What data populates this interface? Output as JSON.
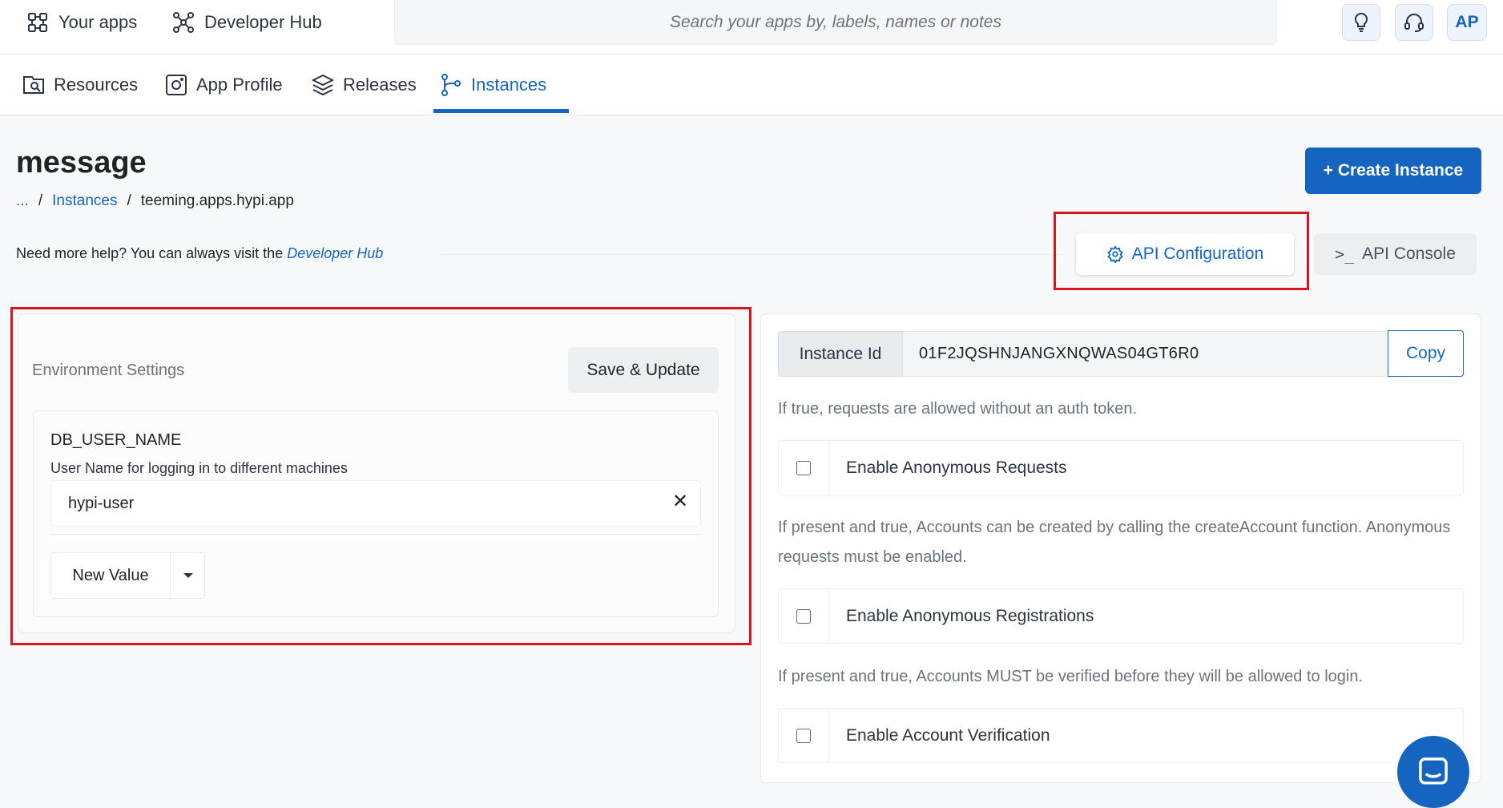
{
  "topbar": {
    "your_apps": "Your apps",
    "developer_hub": "Developer Hub",
    "search_placeholder": "Search your apps by, labels, names or notes",
    "avatar_initials": "AP"
  },
  "tabs": [
    {
      "label": "Resources",
      "icon": "resources-icon"
    },
    {
      "label": "App Profile",
      "icon": "app-profile-icon"
    },
    {
      "label": "Releases",
      "icon": "layers-icon"
    },
    {
      "label": "Instances",
      "icon": "branch-icon",
      "active": true
    }
  ],
  "page": {
    "title": "message",
    "breadcrumb": {
      "ellipsis": "...",
      "sep": "/",
      "instances": "Instances",
      "current": "teeming.apps.hypi.app"
    },
    "create_button": "+ Create Instance",
    "help_prefix": "Need more help? You can always visit the ",
    "help_link": "Developer Hub",
    "api_config": "API Configuration",
    "api_console_prompt": ">_",
    "api_console": "API Console"
  },
  "env": {
    "title": "Environment Settings",
    "save_button": "Save & Update",
    "variable": {
      "name": "DB_USER_NAME",
      "description": "User Name for logging in to different machines",
      "value": "hypi-user"
    },
    "new_value_button": "New Value"
  },
  "config": {
    "instance_id_label": "Instance Id",
    "instance_id_value": "01F2JQSHNJANGXNQWAS04GT6R0",
    "copy_button": "Copy",
    "options": [
      {
        "description": "If true, requests are allowed without an auth token.",
        "label": "Enable Anonymous Requests",
        "checked": false
      },
      {
        "description": "If present and true, Accounts can be created by calling the createAccount function. Anonymous requests must be enabled.",
        "label": "Enable Anonymous Registrations",
        "checked": false
      },
      {
        "description": "If present and true, Accounts MUST be verified before they will be allowed to login.",
        "label": "Enable Account Verification",
        "checked": false
      }
    ]
  },
  "colors": {
    "accent": "#1565c0",
    "highlight": "#d9161d"
  }
}
